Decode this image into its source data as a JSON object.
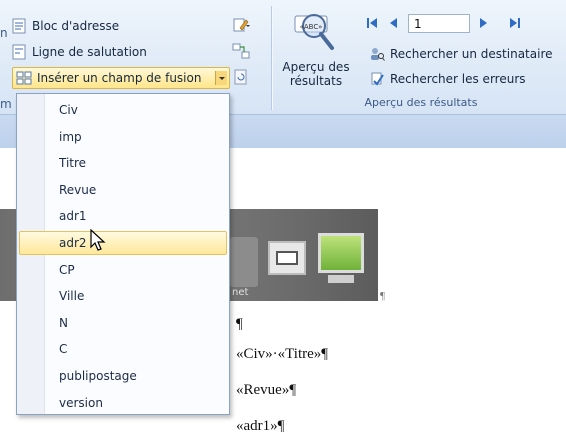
{
  "ribbon": {
    "address_block_label": "Bloc d'adresse",
    "greeting_line_label": "Ligne de salutation",
    "insert_merge_field_label": "Insérer un champ de fusion",
    "left_edge_label": "n",
    "left_edge_label_2": "m",
    "preview_results_label_line1": "Aperçu des",
    "preview_results_label_line2": "résultats",
    "abc_icon_text": "«ABC»",
    "record_number": "1",
    "find_recipient_label": "Rechercher un destinataire",
    "find_errors_label": "Rechercher les erreurs",
    "preview_group_label": "Aperçu des résultats"
  },
  "menu": {
    "items": [
      "Civ",
      "imp",
      "Titre",
      "Revue",
      "adr1",
      "adr2",
      "CP",
      "Ville",
      "N",
      "C",
      "publipostage",
      "version"
    ],
    "hovered_index": 5
  },
  "document": {
    "image_caption": "net",
    "pilcrow_after_image": "¶",
    "empty_paragraph": "¶",
    "line1": "«Civ»·«Titre»¶",
    "line2": "«Revue»¶",
    "line3": "«adr1»¶"
  },
  "colors": {
    "ribbon_bg": "#dfeaf7",
    "highlight": "#ffe58a",
    "accent_blue": "#2e6cc5"
  }
}
